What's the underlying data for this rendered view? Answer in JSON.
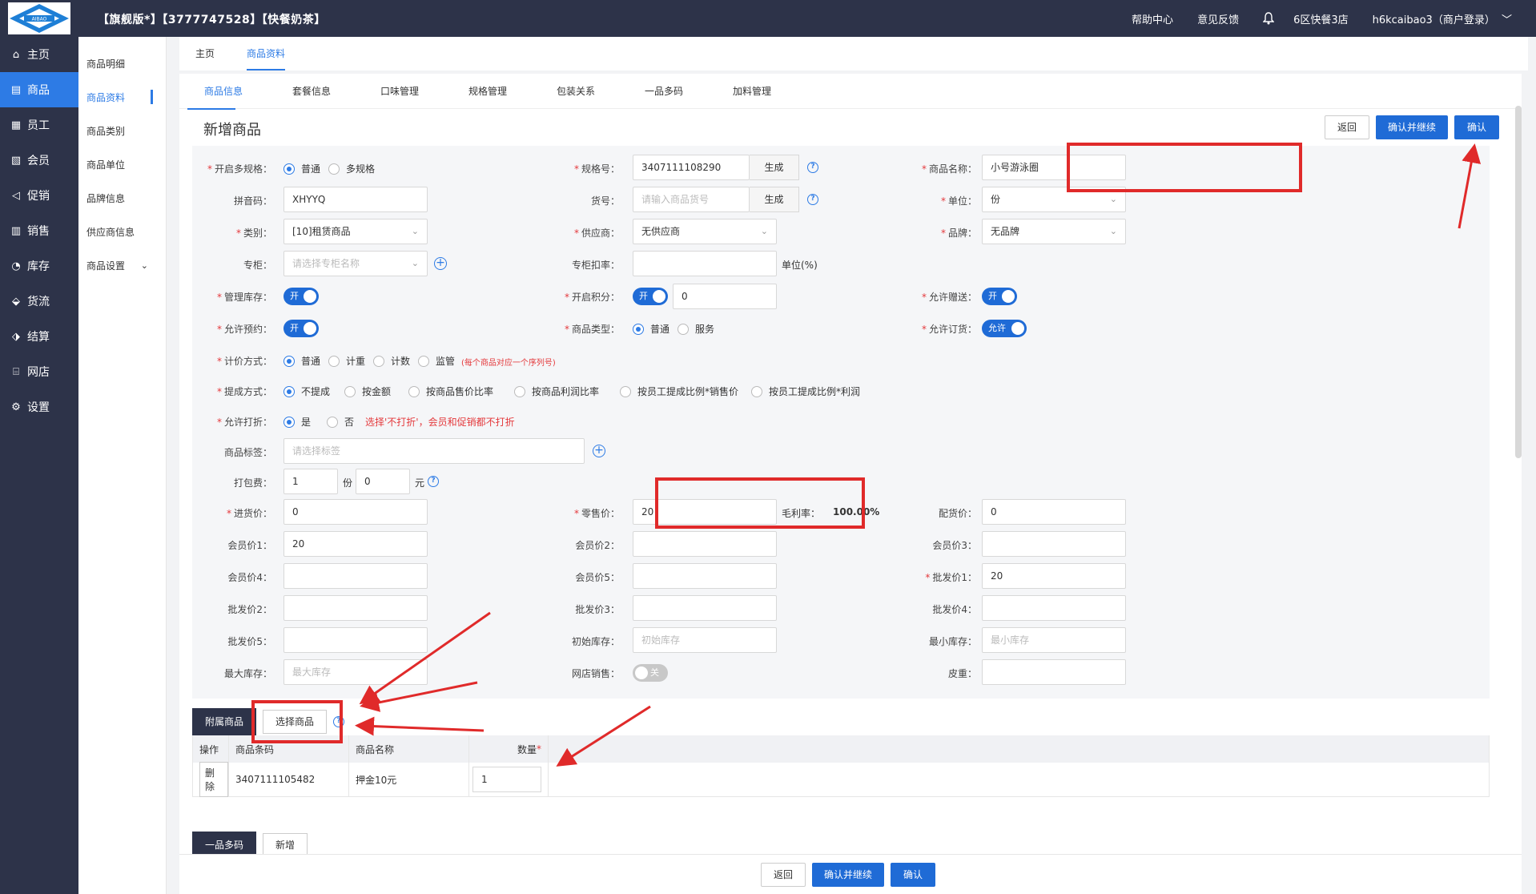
{
  "header": {
    "logo_text": "AIBAO",
    "shop_title": "【旗舰版*】【3777747528】【快餐奶茶】",
    "help": "帮助中心",
    "feedback": "意见反馈",
    "store": "6区快餐3店",
    "user": "h6kcaibao3（商户登录）",
    "user_chevron": "﹀"
  },
  "sidebar": {
    "items": [
      {
        "label": "主页",
        "icon": "home-icon"
      },
      {
        "label": "商品",
        "icon": "goods-icon"
      },
      {
        "label": "员工",
        "icon": "staff-icon"
      },
      {
        "label": "会员",
        "icon": "member-icon"
      },
      {
        "label": "促销",
        "icon": "promo-icon"
      },
      {
        "label": "销售",
        "icon": "sales-icon"
      },
      {
        "label": "库存",
        "icon": "stock-icon"
      },
      {
        "label": "货流",
        "icon": "flow-icon"
      },
      {
        "label": "结算",
        "icon": "settle-icon"
      },
      {
        "label": "网店",
        "icon": "shop-icon"
      },
      {
        "label": "设置",
        "icon": "gear-icon"
      }
    ]
  },
  "subnav": {
    "items": [
      "商品明细",
      "商品资料",
      "商品类别",
      "商品单位",
      "品牌信息",
      "供应商信息",
      "商品设置"
    ]
  },
  "pagetabs": [
    "主页",
    "商品资料"
  ],
  "subtabs": [
    "商品信息",
    "套餐信息",
    "口味管理",
    "规格管理",
    "包装关系",
    "一品多码",
    "加料管理"
  ],
  "page": {
    "title": "新增商品",
    "back": "返回",
    "confirm_continue": "确认并继续",
    "confirm": "确认"
  },
  "form": {
    "multi_spec": {
      "label": "开启多规格：",
      "opt1": "普通",
      "opt2": "多规格"
    },
    "spec_no": {
      "label": "规格号：",
      "value": "3407111108290",
      "gen": "生成"
    },
    "name": {
      "label": "商品名称：",
      "value": "小号游泳圈"
    },
    "pinyin": {
      "label": "拼音码：",
      "value": "XHYYQ"
    },
    "item_no": {
      "label": "货号：",
      "placeholder": "请输入商品货号",
      "gen": "生成"
    },
    "unit": {
      "label": "单位：",
      "value": "份"
    },
    "category": {
      "label": "类别：",
      "value": "[10]租赁商品"
    },
    "supplier": {
      "label": "供应商：",
      "value": "无供应商"
    },
    "brand": {
      "label": "品牌：",
      "value": "无品牌"
    },
    "counter": {
      "label": "专柜：",
      "placeholder": "请选择专柜名称"
    },
    "counter_rate": {
      "label": "专柜扣率：",
      "suffix": "单位(%)"
    },
    "manage_stock": {
      "label": "管理库存：",
      "toggle": "开"
    },
    "points": {
      "label": "开启积分：",
      "toggle": "开",
      "value": "0"
    },
    "allow_gift": {
      "label": "允许赠送：",
      "toggle": "开"
    },
    "allow_reserve": {
      "label": "允许预约：",
      "toggle": "开"
    },
    "goods_type": {
      "label": "商品类型：",
      "opt1": "普通",
      "opt2": "服务"
    },
    "allow_order": {
      "label": "允许订货：",
      "toggle": "允许"
    },
    "pricing": {
      "label": "计价方式：",
      "opts": [
        "普通",
        "计重",
        "计数",
        "监管"
      ],
      "note": "(每个商品对应一个序列号)"
    },
    "commission": {
      "label": "提成方式：",
      "opts": [
        "不提成",
        "按金额",
        "按商品售价比率",
        "按商品利润比率",
        "按员工提成比例*销售价",
        "按员工提成比例*利润"
      ]
    },
    "discount": {
      "label": "允许打折：",
      "opt1": "是",
      "opt2": "否",
      "note": "选择'不打折'，会员和促销都不打折"
    },
    "tags": {
      "label": "商品标签：",
      "placeholder": "请选择标签"
    },
    "pack_fee": {
      "label": "打包费：",
      "qty": "1",
      "qty_unit": "份",
      "price": "0",
      "price_unit": "元"
    },
    "purchase": {
      "label": "进货价：",
      "value": "0"
    },
    "retail": {
      "label": "零售价：",
      "value": "20"
    },
    "margin": {
      "label": "毛利率：",
      "value": "100.00%"
    },
    "dist": {
      "label": "配货价：",
      "value": "0"
    },
    "member1": {
      "label": "会员价1：",
      "value": "20"
    },
    "member2": {
      "label": "会员价2：",
      "value": ""
    },
    "member3": {
      "label": "会员价3：",
      "value": ""
    },
    "member4": {
      "label": "会员价4：",
      "value": ""
    },
    "member5": {
      "label": "会员价5：",
      "value": ""
    },
    "wholesale1": {
      "label": "批发价1：",
      "value": "20"
    },
    "wholesale2": {
      "label": "批发价2：",
      "value": ""
    },
    "wholesale3": {
      "label": "批发价3：",
      "value": ""
    },
    "wholesale4": {
      "label": "批发价4：",
      "value": ""
    },
    "wholesale5": {
      "label": "批发价5：",
      "value": ""
    },
    "init_stock": {
      "label": "初始库存：",
      "placeholder": "初始库存"
    },
    "min_stock": {
      "label": "最小库存：",
      "placeholder": "最小库存"
    },
    "max_stock": {
      "label": "最大库存：",
      "placeholder": "最大库存"
    },
    "online_sale": {
      "label": "网店销售：",
      "toggle": "关"
    },
    "tare": {
      "label": "皮重：",
      "value": ""
    }
  },
  "attach": {
    "tab": "附属商品",
    "select_btn": "选择商品",
    "columns": [
      "操作",
      "商品条码",
      "商品名称",
      "数量"
    ],
    "required_mark": "*",
    "rows": [
      {
        "action": "删除",
        "barcode": "3407111105482",
        "name": "押金10元",
        "qty": "1"
      }
    ]
  },
  "yiping": {
    "tab": "一品多码",
    "add": "新增"
  },
  "colors": {
    "primary": "#1f6bd6",
    "sidebar": "#2d3349",
    "highlight": "#e02a2a"
  }
}
